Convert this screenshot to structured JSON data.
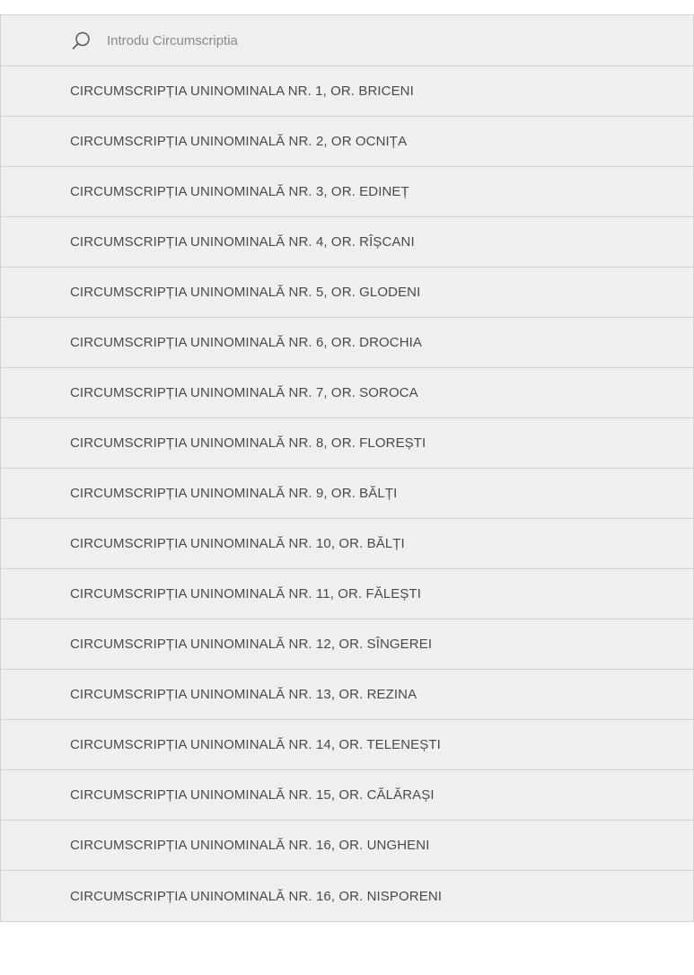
{
  "search": {
    "placeholder": "Introdu Circumscriptia",
    "icon": "search-icon"
  },
  "items": [
    "CIRCUMSCRIPȚIA UNINOMINALA NR. 1, OR. BRICENI",
    "CIRCUMSCRIPȚIA UNINOMINALĂ NR. 2, OR OCNIȚA",
    "CIRCUMSCRIPȚIA UNINOMINALĂ NR. 3, OR. EDINEȚ",
    "CIRCUMSCRIPȚIA UNINOMINALĂ NR. 4, OR. RÎȘCANI",
    "CIRCUMSCRIPȚIA UNINOMINALĂ NR. 5, OR. GLODENI",
    "CIRCUMSCRIPȚIA UNINOMINALĂ NR. 6, OR. DROCHIA",
    "CIRCUMSCRIPȚIA UNINOMINALĂ NR. 7, OR. SOROCA",
    "CIRCUMSCRIPȚIA UNINOMINALĂ NR. 8, OR. FLOREȘTI",
    "CIRCUMSCRIPȚIA UNINOMINALĂ NR. 9, OR. BĂLȚI",
    "CIRCUMSCRIPȚIA UNINOMINALĂ NR. 10, OR. BĂLȚI",
    "CIRCUMSCRIPȚIA UNINOMINALĂ NR. 11, OR. FĂLEȘTI",
    "CIRCUMSCRIPȚIA UNINOMINALĂ NR. 12, OR. SÎNGEREI",
    "CIRCUMSCRIPȚIA UNINOMINALĂ NR. 13, OR. REZINA",
    "CIRCUMSCRIPȚIA UNINOMINALĂ NR. 14, OR. TELENEȘTI",
    "CIRCUMSCRIPȚIA UNINOMINALĂ NR. 15, OR. CĂLĂRAȘI",
    "CIRCUMSCRIPȚIA UNINOMINALĂ NR. 16, OR. UNGHENI",
    "CIRCUMSCRIPȚIA UNINOMINALĂ NR. 16, OR. NISPORENI"
  ]
}
